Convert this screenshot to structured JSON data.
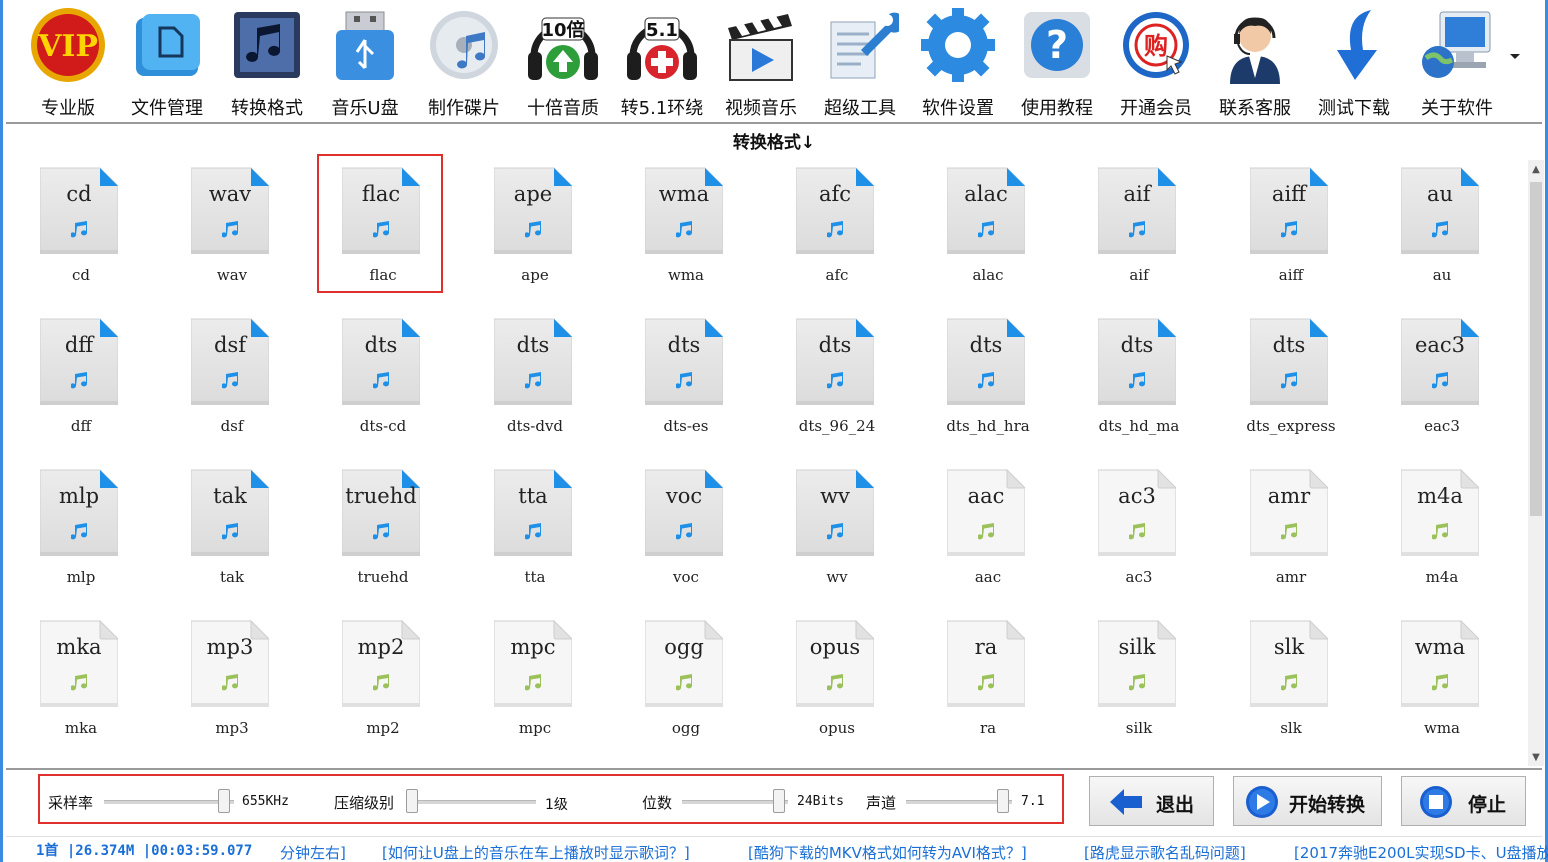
{
  "toolbar": {
    "items": [
      {
        "label": "专业版",
        "icon": "vip-badge-icon"
      },
      {
        "label": "文件管理",
        "icon": "folder-file-icon"
      },
      {
        "label": "转换格式",
        "icon": "music-convert-icon"
      },
      {
        "label": "音乐U盘",
        "icon": "usb-drive-icon"
      },
      {
        "label": "制作碟片",
        "icon": "disc-icon"
      },
      {
        "label": "十倍音质",
        "icon": "headphones-10x-icon"
      },
      {
        "label": "转5.1环绕",
        "icon": "headphones-51-icon"
      },
      {
        "label": "视频音乐",
        "icon": "clapperboard-icon"
      },
      {
        "label": "超级工具",
        "icon": "wrench-tools-icon"
      },
      {
        "label": "软件设置",
        "icon": "gear-icon"
      },
      {
        "label": "使用教程",
        "icon": "help-icon"
      },
      {
        "label": "开通会员",
        "icon": "membership-icon"
      },
      {
        "label": "联系客服",
        "icon": "support-agent-icon"
      },
      {
        "label": "测试下载",
        "icon": "download-arrow-icon"
      },
      {
        "label": "关于软件",
        "icon": "about-computer-icon"
      }
    ],
    "vip_text": "VIP",
    "badge_10x": "10倍",
    "badge_51": "5.1",
    "buy_text": "购"
  },
  "section_title": "转换格式↓",
  "formats": [
    {
      "ext": "cd",
      "label": "cd",
      "style": "blue"
    },
    {
      "ext": "wav",
      "label": "wav",
      "style": "blue"
    },
    {
      "ext": "flac",
      "label": "flac",
      "style": "blue"
    },
    {
      "ext": "ape",
      "label": "ape",
      "style": "blue"
    },
    {
      "ext": "wma",
      "label": "wma",
      "style": "blue"
    },
    {
      "ext": "afc",
      "label": "afc",
      "style": "blue"
    },
    {
      "ext": "alac",
      "label": "alac",
      "style": "blue"
    },
    {
      "ext": "aif",
      "label": "aif",
      "style": "blue"
    },
    {
      "ext": "aiff",
      "label": "aiff",
      "style": "blue"
    },
    {
      "ext": "au",
      "label": "au",
      "style": "blue"
    },
    {
      "ext": "dff",
      "label": "dff",
      "style": "blue"
    },
    {
      "ext": "dsf",
      "label": "dsf",
      "style": "blue"
    },
    {
      "ext": "dts",
      "label": "dts-cd",
      "style": "blue"
    },
    {
      "ext": "dts",
      "label": "dts-dvd",
      "style": "blue"
    },
    {
      "ext": "dts",
      "label": "dts-es",
      "style": "blue"
    },
    {
      "ext": "dts",
      "label": "dts_96_24",
      "style": "blue"
    },
    {
      "ext": "dts",
      "label": "dts_hd_hra",
      "style": "blue"
    },
    {
      "ext": "dts",
      "label": "dts_hd_ma",
      "style": "blue"
    },
    {
      "ext": "dts",
      "label": "dts_express",
      "style": "blue"
    },
    {
      "ext": "eac3",
      "label": "eac3",
      "style": "blue"
    },
    {
      "ext": "mlp",
      "label": "mlp",
      "style": "blue"
    },
    {
      "ext": "tak",
      "label": "tak",
      "style": "blue"
    },
    {
      "ext": "truehd",
      "label": "truehd",
      "style": "blue"
    },
    {
      "ext": "tta",
      "label": "tta",
      "style": "blue"
    },
    {
      "ext": "voc",
      "label": "voc",
      "style": "blue"
    },
    {
      "ext": "wv",
      "label": "wv",
      "style": "blue"
    },
    {
      "ext": "aac",
      "label": "aac",
      "style": "green"
    },
    {
      "ext": "ac3",
      "label": "ac3",
      "style": "green"
    },
    {
      "ext": "amr",
      "label": "amr",
      "style": "green"
    },
    {
      "ext": "m4a",
      "label": "m4a",
      "style": "green"
    },
    {
      "ext": "mka",
      "label": "mka",
      "style": "green"
    },
    {
      "ext": "mp3",
      "label": "mp3",
      "style": "green"
    },
    {
      "ext": "mp2",
      "label": "mp2",
      "style": "green"
    },
    {
      "ext": "mpc",
      "label": "mpc",
      "style": "green"
    },
    {
      "ext": "ogg",
      "label": "ogg",
      "style": "green"
    },
    {
      "ext": "opus",
      "label": "opus",
      "style": "green"
    },
    {
      "ext": "ra",
      "label": "ra",
      "style": "green"
    },
    {
      "ext": "silk",
      "label": "silk",
      "style": "green"
    },
    {
      "ext": "slk",
      "label": "slk",
      "style": "green"
    },
    {
      "ext": "wma",
      "label": "wma",
      "style": "green"
    }
  ],
  "selected_format": "flac",
  "settings": {
    "sample_rate_label": "采样率",
    "sample_rate_value": "655KHz",
    "sample_rate_level": 0.97,
    "compression_label": "压缩级别",
    "compression_value": "1级",
    "compression_level": 0.0,
    "bits_label": "位数",
    "bits_value": "24Bits",
    "bits_level": 0.97,
    "channels_label": "声道",
    "channels_value": "7.1",
    "channels_level": 0.97
  },
  "buttons": {
    "exit_label": "退出",
    "start_label": "开始转换",
    "stop_label": "停止"
  },
  "status": {
    "counter": "1首 |26.374M |00:03:59.077",
    "links": [
      "分钟左右]",
      "[如何让U盘上的音乐在车上播放时显示歌词？]",
      "[酷狗下载的MKV格式如何转为AVI格式？]",
      "[路虎显示歌名乱码问题]",
      "[2017奔驰E200L实现SD卡、U盘播放"
    ]
  },
  "colors": {
    "window_border": "#3c8be0",
    "highlight": "#e0302b",
    "doc_corner_blue": "#1e90e8",
    "note_blue": "#1e90e8",
    "note_green": "#9bc25a",
    "link_blue": "#1b6fd6"
  }
}
